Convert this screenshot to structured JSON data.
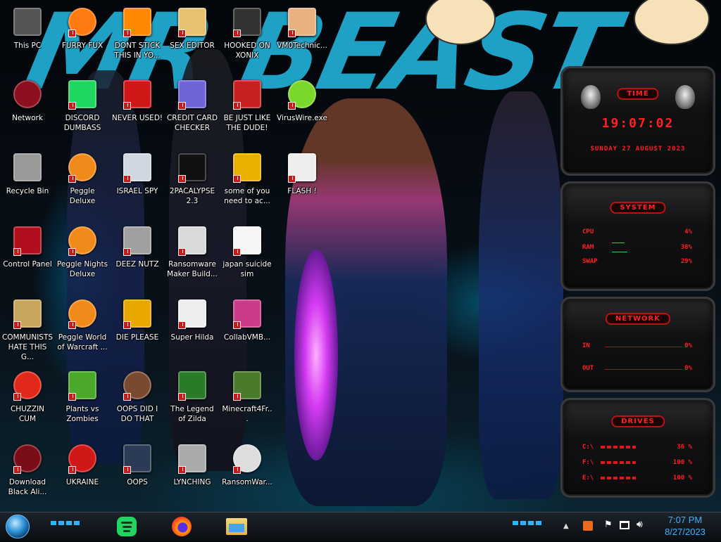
{
  "wallpaper": {
    "title_text": "MR BEAST"
  },
  "desktop_icons": [
    {
      "label": "This PC",
      "icon": "this-pc-icon"
    },
    {
      "label": "Network",
      "icon": "network-icon"
    },
    {
      "label": "Recycle Bin",
      "icon": "recycle-bin-icon"
    },
    {
      "label": "Control Panel",
      "icon": "control-panel-icon"
    },
    {
      "label": "COMMUNISTS HATE THIS G...",
      "icon": "money-bag-icon"
    },
    {
      "label": "CHUZZIN CUM",
      "icon": "chuzzle-icon"
    },
    {
      "label": "Download Black Ali...",
      "icon": "alien-download-icon"
    },
    {
      "label": "FURRY FUX",
      "icon": "firefox-icon"
    },
    {
      "label": "DISCORD DUMBASS",
      "icon": "discord-icon"
    },
    {
      "label": "Peggle Deluxe",
      "icon": "peggle-icon"
    },
    {
      "label": "Peggle Nights Deluxe",
      "icon": "peggle-nights-icon"
    },
    {
      "label": "Peggle World of Warcraft ...",
      "icon": "peggle-wow-icon"
    },
    {
      "label": "Plants vs Zombies",
      "icon": "plants-vs-zombies-icon"
    },
    {
      "label": "UKRAINE",
      "icon": "radiation-icon"
    },
    {
      "label": "DONT STICK THIS IN YO...",
      "icon": "vlc-cone-icon"
    },
    {
      "label": "NEVER USED!",
      "icon": "dev-icon"
    },
    {
      "label": "ISRAEL SPY",
      "icon": "folder-app-icon"
    },
    {
      "label": "DEEZ NUTZ",
      "icon": "window-stack-icon"
    },
    {
      "label": "DIE PLEASE",
      "icon": "de-app-icon"
    },
    {
      "label": "OOPS DID I DO THAT",
      "icon": "portrait-icon"
    },
    {
      "label": "OOPS",
      "icon": "computer-doc-icon"
    },
    {
      "label": "SEX EDITOR",
      "icon": "hex-editor-icon"
    },
    {
      "label": "CREDIT CARD CHECKER",
      "icon": "credit-card-icon"
    },
    {
      "label": "2PACALYPSE 2.3",
      "icon": "terminal-icon"
    },
    {
      "label": "Ransomware Maker Build...",
      "icon": "app-window-icon"
    },
    {
      "label": "Super Hilda",
      "icon": "pixel-sprite-icon"
    },
    {
      "label": "The Legend of Zilda",
      "icon": "zelda-sprite-icon"
    },
    {
      "label": "LYNCHING",
      "icon": "rope-icon"
    },
    {
      "label": "HOOKED ON XONIX",
      "icon": "xonix-icon"
    },
    {
      "label": "BE JUST LIKE THE DUDE!",
      "icon": "santa-icon"
    },
    {
      "label": "some of you need to ac...",
      "icon": "hamster-icon"
    },
    {
      "label": "japan suicide sim",
      "icon": "document-icon"
    },
    {
      "label": "CollabVMB...",
      "icon": "monitor-icon"
    },
    {
      "label": "Minecraft4Fr...",
      "icon": "minecraft-block-icon"
    },
    {
      "label": "RansomWar...",
      "icon": "skull-icon"
    },
    {
      "label": "VM0Technic...",
      "icon": "doctor-icon"
    },
    {
      "label": "VirusWire.exe",
      "icon": "lime-icon"
    },
    {
      "label": "FLASH !",
      "icon": "flash-doc-icon"
    }
  ],
  "widgets": {
    "time": {
      "title": "TIME",
      "clock": "19:07:02",
      "date": "SUNDAY 27 AUGUST 2023"
    },
    "system": {
      "title": "SYSTEM",
      "rows": [
        {
          "label": "CPU",
          "value": "4%"
        },
        {
          "label": "RAM",
          "value": "38%"
        },
        {
          "label": "SWAP",
          "value": "29%"
        }
      ]
    },
    "network": {
      "title": "NETWORK",
      "rows": [
        {
          "label": "IN",
          "value": "0%"
        },
        {
          "label": "OUT",
          "value": "0%"
        }
      ]
    },
    "drives": {
      "title": "DRIVES",
      "rows": [
        {
          "label": "C:\\",
          "value": "36 %"
        },
        {
          "label": "F:\\",
          "value": "100 %"
        },
        {
          "label": "E:\\",
          "value": "100 %"
        }
      ]
    }
  },
  "taskbar": {
    "pinned": [
      "spotify-icon",
      "firefox-icon",
      "file-explorer-icon"
    ],
    "clock_time": "7:07 PM",
    "clock_date": "8/27/2023",
    "accent": "#2bb7ff"
  }
}
